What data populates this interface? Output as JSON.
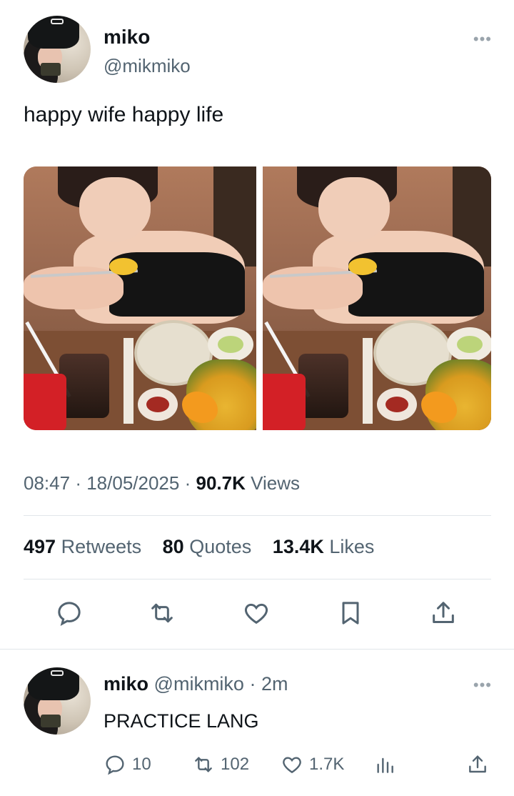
{
  "tweet": {
    "author_name": "miko",
    "author_handle": "@mikmiko",
    "more_icon": "more-dots-icon",
    "text": "happy wife happy life",
    "time": "08:47",
    "date": "18/05/2025",
    "views_count": "90.7K",
    "views_label": "Views",
    "separator": "·"
  },
  "stats": {
    "retweets_count": "497",
    "retweets_label": "Retweets",
    "quotes_count": "80",
    "quotes_label": "Quotes",
    "likes_count": "13.4K",
    "likes_label": "Likes"
  },
  "actions": {
    "icons": [
      "reply-icon",
      "retweet-icon",
      "like-icon",
      "bookmark-icon",
      "share-icon"
    ]
  },
  "reply": {
    "author_name": "miko",
    "author_handle": "@mikmiko",
    "time": "· 2m",
    "text": "PRACTICE LANG",
    "reply_count": "10",
    "retweet_count": "102",
    "like_count": "1.7K"
  },
  "colors": {
    "text": "#0f1419",
    "secondary": "#536471",
    "divider": "#e1e6ea"
  }
}
